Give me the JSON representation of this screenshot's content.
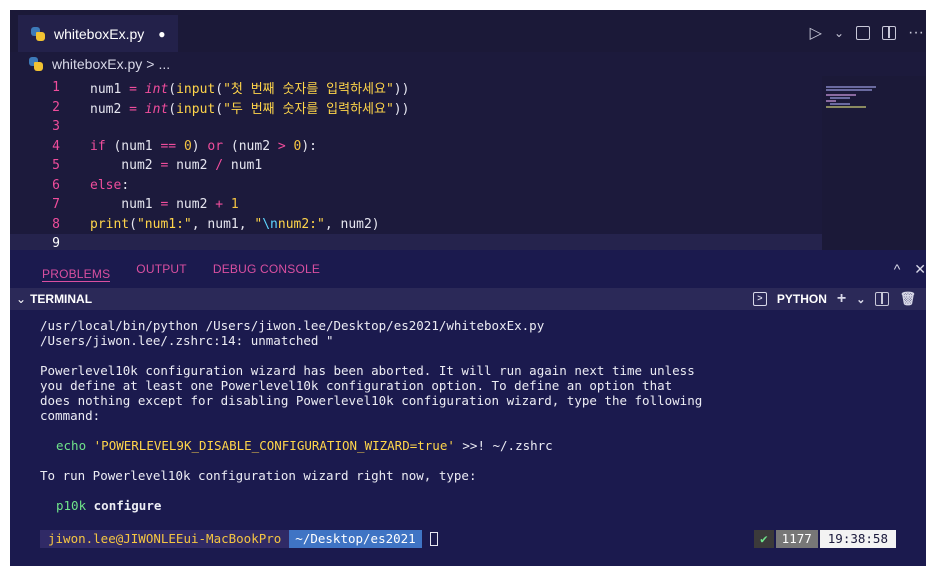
{
  "tab": {
    "filename": "whiteboxEx.py",
    "dirty_marker": "●"
  },
  "tab_actions": {
    "run": "▷",
    "run_menu": "⌄",
    "more": "···"
  },
  "breadcrumb": {
    "file": "whiteboxEx.py",
    "separator": ">",
    "trail": "..."
  },
  "editor": {
    "lines": [
      {
        "num": "1",
        "tokens": [
          [
            "",
            "num1 "
          ],
          [
            "op",
            "="
          ],
          [
            "",
            " "
          ],
          [
            "bi",
            "int"
          ],
          [
            "",
            "("
          ],
          [
            "fn",
            "input"
          ],
          [
            "",
            "("
          ],
          [
            "str",
            "\"첫 번째 숫자를 입력하세요\""
          ],
          [
            "",
            "))"
          ]
        ]
      },
      {
        "num": "2",
        "tokens": [
          [
            "",
            "num2 "
          ],
          [
            "op",
            "="
          ],
          [
            "",
            " "
          ],
          [
            "bi",
            "int"
          ],
          [
            "",
            "("
          ],
          [
            "fn",
            "input"
          ],
          [
            "",
            "("
          ],
          [
            "str",
            "\"두 번째 숫자를 입력하세요\""
          ],
          [
            "",
            "))"
          ]
        ]
      },
      {
        "num": "3",
        "tokens": []
      },
      {
        "num": "4",
        "tokens": [
          [
            "kw",
            "if"
          ],
          [
            "",
            " (num1 "
          ],
          [
            "op",
            "=="
          ],
          [
            "",
            " "
          ],
          [
            "num",
            "0"
          ],
          [
            "",
            ") "
          ],
          [
            "kw",
            "or"
          ],
          [
            "",
            " (num2 "
          ],
          [
            "op",
            ">"
          ],
          [
            "",
            " "
          ],
          [
            "num",
            "0"
          ],
          [
            "",
            "):"
          ]
        ]
      },
      {
        "num": "5",
        "tokens": [
          [
            "",
            "    num2 "
          ],
          [
            "op",
            "="
          ],
          [
            "",
            " num2 "
          ],
          [
            "op",
            "/"
          ],
          [
            "",
            " num1"
          ]
        ]
      },
      {
        "num": "6",
        "tokens": [
          [
            "kw",
            "else"
          ],
          [
            "",
            ":"
          ]
        ]
      },
      {
        "num": "7",
        "tokens": [
          [
            "",
            "    num1 "
          ],
          [
            "op",
            "="
          ],
          [
            "",
            " num2 "
          ],
          [
            "op",
            "+"
          ],
          [
            "",
            " "
          ],
          [
            "num",
            "1"
          ]
        ]
      },
      {
        "num": "8",
        "tokens": [
          [
            "fn",
            "print"
          ],
          [
            "",
            "("
          ],
          [
            "str",
            "\"num1:\""
          ],
          [
            "",
            ", num1, "
          ],
          [
            "str",
            "\""
          ],
          [
            "esc",
            "\\n"
          ],
          [
            "str",
            "num2:\""
          ],
          [
            "",
            ", num2)"
          ]
        ]
      },
      {
        "num": "9",
        "tokens": []
      }
    ]
  },
  "panel": {
    "tabs": [
      "PROBLEMS",
      "OUTPUT",
      "DEBUG CONSOLE"
    ],
    "active_tab": "PROBLEMS",
    "maximize": "^",
    "close": "✕"
  },
  "terminal_header": {
    "title": "TERMINAL",
    "shell": "PYTHON",
    "new": "+",
    "new_menu": "⌄"
  },
  "terminal": {
    "lines": [
      "/usr/local/bin/python /Users/jiwon.lee/Desktop/es2021/whiteboxEx.py",
      "/Users/jiwon.lee/.zshrc:14: unmatched \"",
      "Powerlevel10k configuration wizard has been aborted. It will run again next time unless",
      "you define at least one Powerlevel10k configuration option. To define an option that",
      "does nothing except for disabling Powerlevel10k configuration wizard, type the following",
      "command:",
      "To run Powerlevel10k configuration wizard right now, type:"
    ],
    "echo_cmd": "echo",
    "echo_arg": "'POWERLEVEL9K_DISABLE_CONFIGURATION_WIZARD=true'",
    "echo_rest": " >>! ~/.zshrc",
    "p10k_cmd": "p10k",
    "p10k_arg": "configure",
    "prompt_user": "jiwon.lee@JIWONLEEui-MacBookPro",
    "prompt_path": "~/Desktop/es2021",
    "status_check": "✔",
    "history_count": "1177",
    "time": "19:38:58"
  },
  "colors": {
    "accent": "#d94fa0",
    "background": "#1c1a3c",
    "panel": "#1b1a4e",
    "string": "#ffd54a"
  }
}
